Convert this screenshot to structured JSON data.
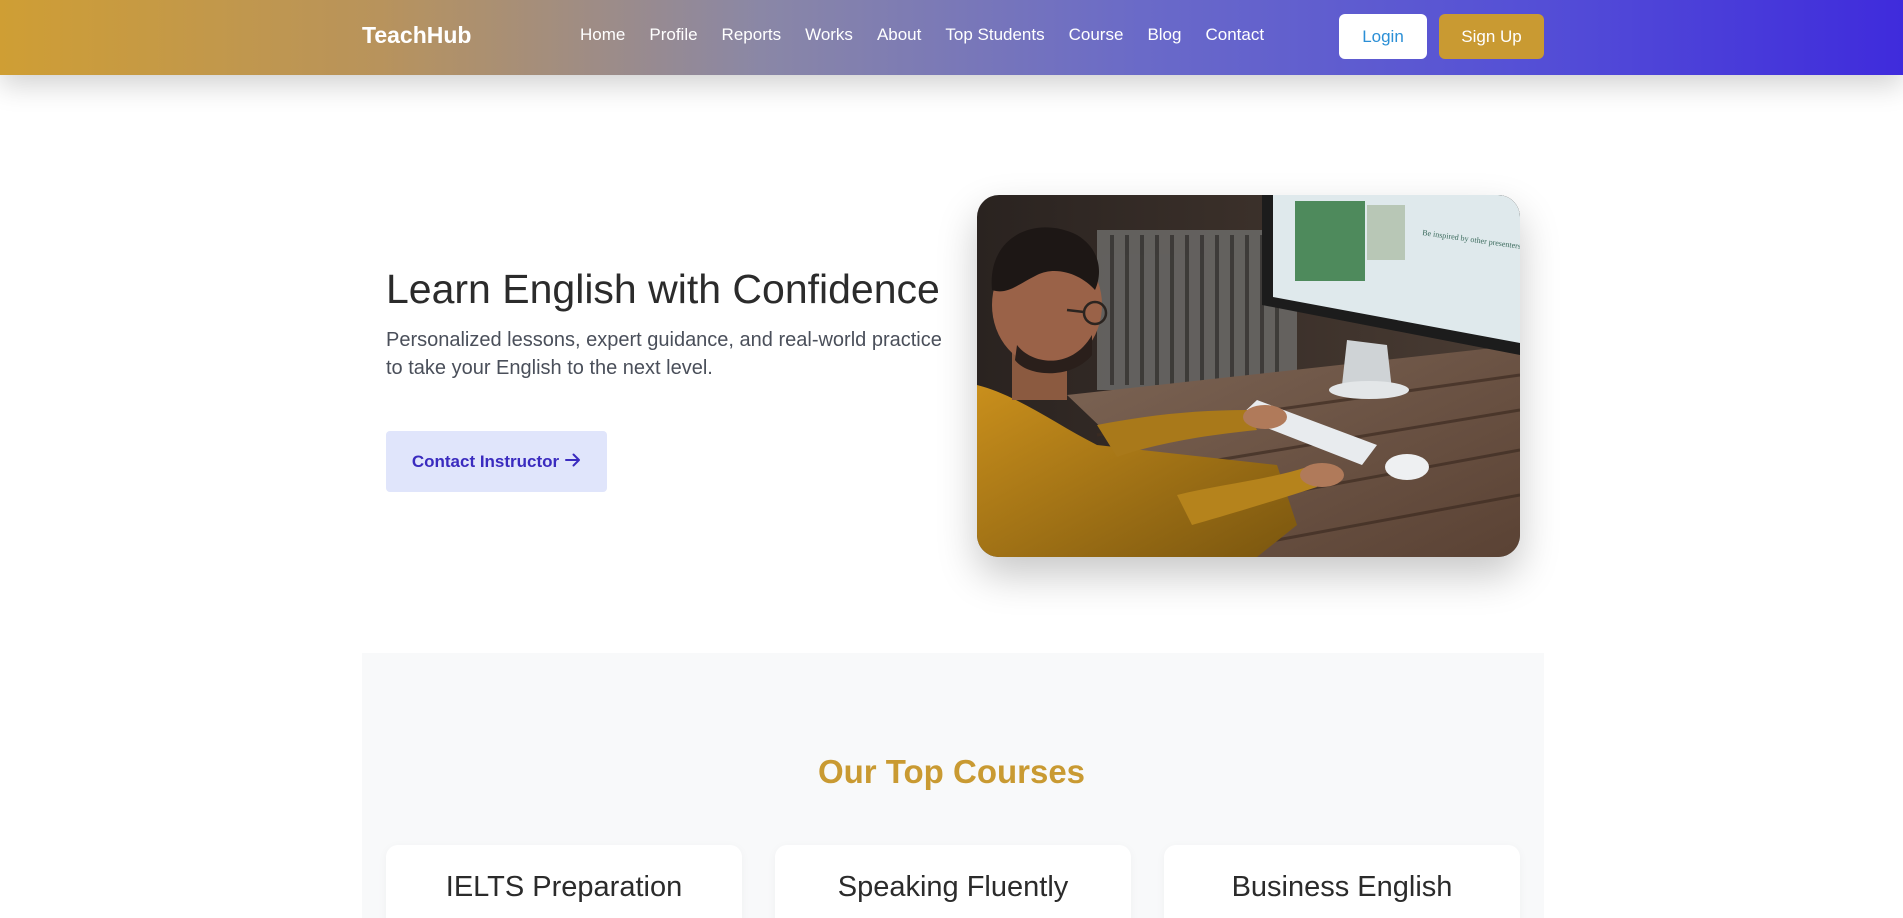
{
  "brand": {
    "name": "TeachHub"
  },
  "nav": {
    "links": [
      "Home",
      "Profile",
      "Reports",
      "Works",
      "About",
      "Top Students",
      "Course",
      "Blog",
      "Contact"
    ],
    "login_label": "Login",
    "signup_label": "Sign Up"
  },
  "hero": {
    "title": "Learn English with Confidence",
    "subtitle": "Personalized lessons, expert guidance, and real-world practice to take your English to the next level.",
    "cta_label": "Contact Instructor",
    "cta_icon": "arrow-right-icon",
    "image_screen_heading": "Be inspired by other presenters"
  },
  "courses": {
    "heading": "Our Top Courses",
    "items": [
      {
        "name": "IELTS Preparation"
      },
      {
        "name": "Speaking Fluently"
      },
      {
        "name": "Business English"
      }
    ]
  },
  "colors": {
    "accent_gold": "#c99a32",
    "accent_indigo": "#3f2bdc",
    "cta_bg": "#e0e5fb",
    "login_text": "#2b8fd6"
  }
}
